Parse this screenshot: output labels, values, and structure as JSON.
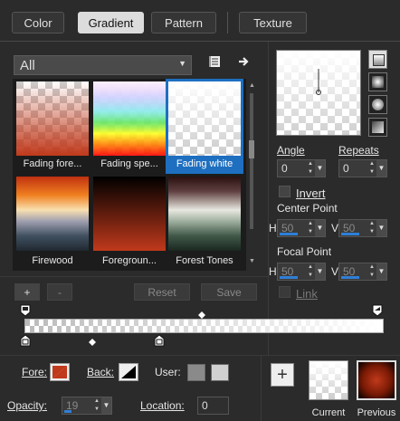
{
  "tabs": [
    {
      "label": "Color"
    },
    {
      "label": "Gradient"
    },
    {
      "label": "Pattern"
    },
    {
      "label": "Texture"
    }
  ],
  "library": {
    "category": "All",
    "thumbnails": [
      {
        "name": "Fading fore..."
      },
      {
        "name": "Fading spe..."
      },
      {
        "name": "Fading white"
      },
      {
        "name": "Firewood"
      },
      {
        "name": "Foregroun..."
      },
      {
        "name": "Forest Tones"
      }
    ],
    "selected_index": 2
  },
  "stop_buttons": {
    "add": "+",
    "remove": "-"
  },
  "actions": {
    "reset": "Reset",
    "save": "Save"
  },
  "angle": {
    "label": "Angle",
    "value": "0"
  },
  "repeats": {
    "label": "Repeats",
    "value": "0"
  },
  "invert": {
    "label": "Invert"
  },
  "center_point": {
    "label": "Center Point",
    "h_label": "H",
    "h_value": "50",
    "v_label": "V",
    "v_value": "50"
  },
  "focal_point": {
    "label": "Focal Point",
    "h_label": "H",
    "h_value": "50",
    "v_label": "V",
    "v_value": "50"
  },
  "link": {
    "label": "Link"
  },
  "fore": {
    "label": "Fore:"
  },
  "back": {
    "label": "Back:"
  },
  "user": {
    "label": "User:"
  },
  "opacity": {
    "label": "Opacity:",
    "value": "19"
  },
  "location": {
    "label": "Location:",
    "value": "0"
  },
  "bottom": {
    "current": "Current",
    "previous": "Previous"
  },
  "colors": {
    "accent": "#1e6fc0",
    "fore_swatch": "#c0391b",
    "user1": "#8a8a8a",
    "user2": "#d0d0d0"
  }
}
